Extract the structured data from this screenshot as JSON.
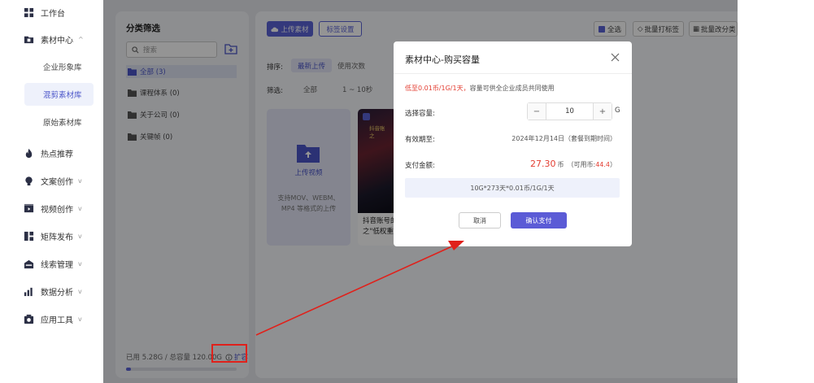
{
  "sidebar": {
    "items": [
      {
        "label": "工作台",
        "icon": "grid-icon"
      },
      {
        "label": "素材中心",
        "icon": "folder-icon",
        "chevron": "^"
      },
      {
        "label": "热点推荐",
        "icon": "fire-icon",
        "chevron": ""
      },
      {
        "label": "文案创作",
        "icon": "bulb-icon",
        "chevron": "v"
      },
      {
        "label": "视频创作",
        "icon": "video-icon",
        "chevron": "v"
      },
      {
        "label": "矩阵发布",
        "icon": "matrix-icon",
        "chevron": "v"
      },
      {
        "label": "线索管理",
        "icon": "lead-icon",
        "chevron": "v"
      },
      {
        "label": "数据分析",
        "icon": "chart-icon",
        "chevron": "v"
      },
      {
        "label": "应用工具",
        "icon": "tool-icon",
        "chevron": "v"
      }
    ],
    "sub_items": [
      {
        "label": "企业形象库"
      },
      {
        "label": "混剪素材库"
      },
      {
        "label": "原始素材库"
      }
    ]
  },
  "filter_panel": {
    "title": "分类筛选",
    "search_placeholder": "搜索",
    "categories": [
      {
        "label": "全部  (3)"
      },
      {
        "label": "课程体系  (0)"
      },
      {
        "label": "关于公司  (0)"
      },
      {
        "label": "关键帧  (0)"
      }
    ],
    "storage_text": "已用 5.28G / 总容量 120.00G",
    "expand_label": "扩容",
    "used_fraction": 0.044
  },
  "content": {
    "upload_material_label": "上传素材",
    "tag_settings_label": "标签设置",
    "select_all_label": "全选",
    "batch_tag_label": "批量打标签",
    "batch_category_label": "批量改分类",
    "sort_label": "排序:",
    "sort_options": [
      "最新上传",
      "使用次数"
    ],
    "filter_label": "筛选:",
    "filter_options": [
      "全部",
      "1 ~ 10秒"
    ],
    "upload_card": {
      "title": "上传视频",
      "desc": "支持MOV、WEBM、MP4 等格式的上传"
    },
    "video_card": {
      "caption": "抖音账\n之",
      "title_line1": "抖音账号的",
      "title_line2": "之\"低权重\""
    }
  },
  "modal": {
    "title": "素材中心-购买容量",
    "note_red": "低至0.01币/1G/1天，",
    "note_rest": "容量可供全企业成员共同使用",
    "capacity_label": "选择容量:",
    "capacity_value": "10",
    "capacity_unit": "G",
    "minus": "−",
    "plus": "+",
    "expiry_label": "有效期至:",
    "expiry_value": "2024年12月14日（套餐到期时间）",
    "payment_label": "支付金额:",
    "payment_amount": "27.30",
    "payment_unit": "币",
    "available_prefix": "（可用币:",
    "available_value": "44.4",
    "available_suffix": "）",
    "formula": "10G*273天*0.01币/1G/1天",
    "cancel_label": "取消",
    "confirm_label": "确认支付"
  },
  "colors": {
    "accent": "#5b63d6",
    "annotation_red": "#e0211b",
    "price_red": "#e33d31"
  }
}
